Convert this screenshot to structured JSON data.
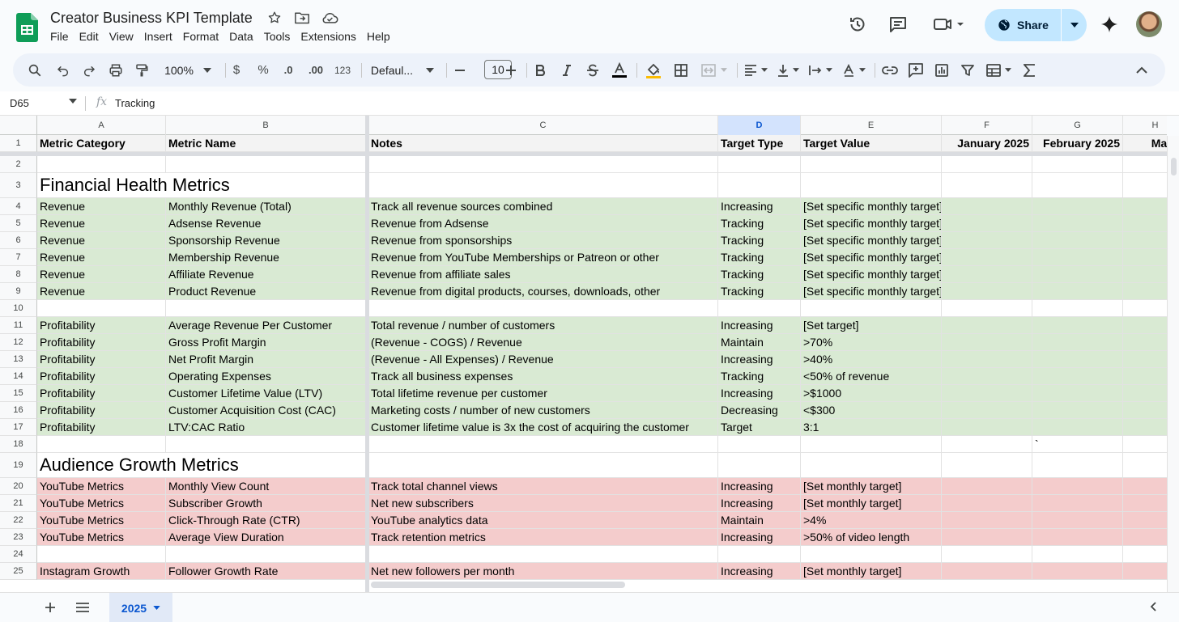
{
  "app": {
    "doc_title": "Creator Business KPI Template",
    "menu": [
      "File",
      "Edit",
      "View",
      "Insert",
      "Format",
      "Data",
      "Tools",
      "Extensions",
      "Help"
    ],
    "share_label": "Share"
  },
  "toolbar": {
    "zoom": "100%",
    "currency": "$",
    "percent": "%",
    "dec_decrease": ".0",
    "dec_increase": ".00",
    "number_format": "123",
    "font": "Defaul...",
    "font_size": "10"
  },
  "formula_bar": {
    "cell_ref": "D65",
    "fx": "fx",
    "value": "Tracking"
  },
  "columns": [
    "A",
    "B",
    "C",
    "D",
    "E",
    "F",
    "G",
    "H"
  ],
  "selected_column": "D",
  "header_row": {
    "num": "1",
    "cells": [
      "Metric Category",
      "Metric Name",
      "Notes",
      "Target Type",
      "Target Value",
      "January 2025",
      "February 2025",
      "March"
    ]
  },
  "rows": [
    {
      "num": "2",
      "style": "blank",
      "cells": [
        "",
        "",
        "",
        "",
        "",
        "",
        "",
        ""
      ]
    },
    {
      "num": "3",
      "style": "section",
      "title": "Financial Health Metrics"
    },
    {
      "num": "4",
      "style": "green",
      "cells": [
        "Revenue",
        "Monthly Revenue (Total)",
        "Track all revenue sources combined",
        "Increasing",
        "[Set specific monthly target]",
        "",
        "",
        ""
      ]
    },
    {
      "num": "5",
      "style": "green",
      "cells": [
        "Revenue",
        "Adsense Revenue",
        "Revenue from Adsense",
        "Tracking",
        "[Set specific monthly target]",
        "",
        "",
        ""
      ]
    },
    {
      "num": "6",
      "style": "green",
      "cells": [
        "Revenue",
        "Sponsorship Revenue",
        "Revenue from sponsorships",
        "Tracking",
        "[Set specific monthly target]",
        "",
        "",
        ""
      ]
    },
    {
      "num": "7",
      "style": "green",
      "cells": [
        "Revenue",
        "Membership Revenue",
        "Revenue from YouTube Memberships or Patreon or other",
        "Tracking",
        "[Set specific monthly target]",
        "",
        "",
        ""
      ]
    },
    {
      "num": "8",
      "style": "green",
      "cells": [
        "Revenue",
        "Affiliate Revenue",
        "Revenue from affiliate sales",
        "Tracking",
        "[Set specific monthly target]",
        "",
        "",
        ""
      ]
    },
    {
      "num": "9",
      "style": "green",
      "cells": [
        "Revenue",
        "Product Revenue",
        "Revenue from digital products, courses, downloads, other",
        "Tracking",
        "[Set specific monthly target]",
        "",
        "",
        ""
      ]
    },
    {
      "num": "10",
      "style": "blank",
      "cells": [
        "",
        "",
        "",
        "",
        "",
        "",
        "",
        ""
      ]
    },
    {
      "num": "11",
      "style": "green",
      "cells": [
        "Profitability",
        "Average Revenue Per Customer",
        "Total revenue / number of customers",
        "Increasing",
        "[Set target]",
        "",
        "",
        ""
      ]
    },
    {
      "num": "12",
      "style": "green",
      "cells": [
        "Profitability",
        "Gross Profit Margin",
        "(Revenue - COGS) / Revenue",
        "Maintain",
        ">70%",
        "",
        "",
        ""
      ]
    },
    {
      "num": "13",
      "style": "green",
      "cells": [
        "Profitability",
        "Net Profit Margin",
        "(Revenue - All Expenses) / Revenue",
        "Increasing",
        ">40%",
        "",
        "",
        ""
      ]
    },
    {
      "num": "14",
      "style": "green",
      "cells": [
        "Profitability",
        "Operating Expenses",
        "Track all business expenses",
        "Tracking",
        "<50% of revenue",
        "",
        "",
        ""
      ]
    },
    {
      "num": "15",
      "style": "green",
      "cells": [
        "Profitability",
        "Customer Lifetime Value (LTV)",
        "Total lifetime revenue per customer",
        "Increasing",
        ">$1000",
        "",
        "",
        ""
      ]
    },
    {
      "num": "16",
      "style": "green",
      "cells": [
        "Profitability",
        "Customer Acquisition Cost (CAC)",
        "Marketing costs / number of new customers",
        "Decreasing",
        "<$300",
        "",
        "",
        ""
      ]
    },
    {
      "num": "17",
      "style": "green",
      "cells": [
        "Profitability",
        "LTV:CAC Ratio",
        "Customer lifetime value is 3x the cost of acquiring the customer",
        "Target",
        "3:1",
        "",
        "",
        ""
      ]
    },
    {
      "num": "18",
      "style": "blank",
      "cells": [
        "",
        "",
        "",
        "",
        "",
        "",
        "`",
        ""
      ]
    },
    {
      "num": "19",
      "style": "section",
      "title": "Audience Growth Metrics"
    },
    {
      "num": "20",
      "style": "red",
      "cells": [
        "YouTube Metrics",
        "Monthly View Count",
        "Track total channel views",
        "Increasing",
        "[Set monthly target]",
        "",
        "",
        ""
      ]
    },
    {
      "num": "21",
      "style": "red",
      "cells": [
        "YouTube Metrics",
        "Subscriber Growth",
        "Net new subscribers",
        "Increasing",
        "[Set monthly target]",
        "",
        "",
        ""
      ]
    },
    {
      "num": "22",
      "style": "red",
      "cells": [
        "YouTube Metrics",
        "Click-Through Rate (CTR)",
        "YouTube analytics data",
        "Maintain",
        ">4%",
        "",
        "",
        ""
      ]
    },
    {
      "num": "23",
      "style": "red",
      "cells": [
        "YouTube Metrics",
        "Average View Duration",
        "Track retention metrics",
        "Increasing",
        ">50% of video length",
        "",
        "",
        ""
      ]
    },
    {
      "num": "24",
      "style": "blank",
      "cells": [
        "",
        "",
        "",
        "",
        "",
        "",
        "",
        ""
      ]
    },
    {
      "num": "25",
      "style": "red",
      "cells": [
        "Instagram Growth",
        "Follower Growth Rate",
        "Net new followers per month",
        "Increasing",
        "[Set monthly target]",
        "",
        "",
        ""
      ]
    }
  ],
  "sheet_tabs": [
    {
      "label": "2025",
      "active": true
    }
  ],
  "colors": {
    "green_fill": "#d9ead3",
    "red_fill": "#f4cccc",
    "accent": "#0b57d0",
    "share_bg": "#c2e7ff"
  }
}
